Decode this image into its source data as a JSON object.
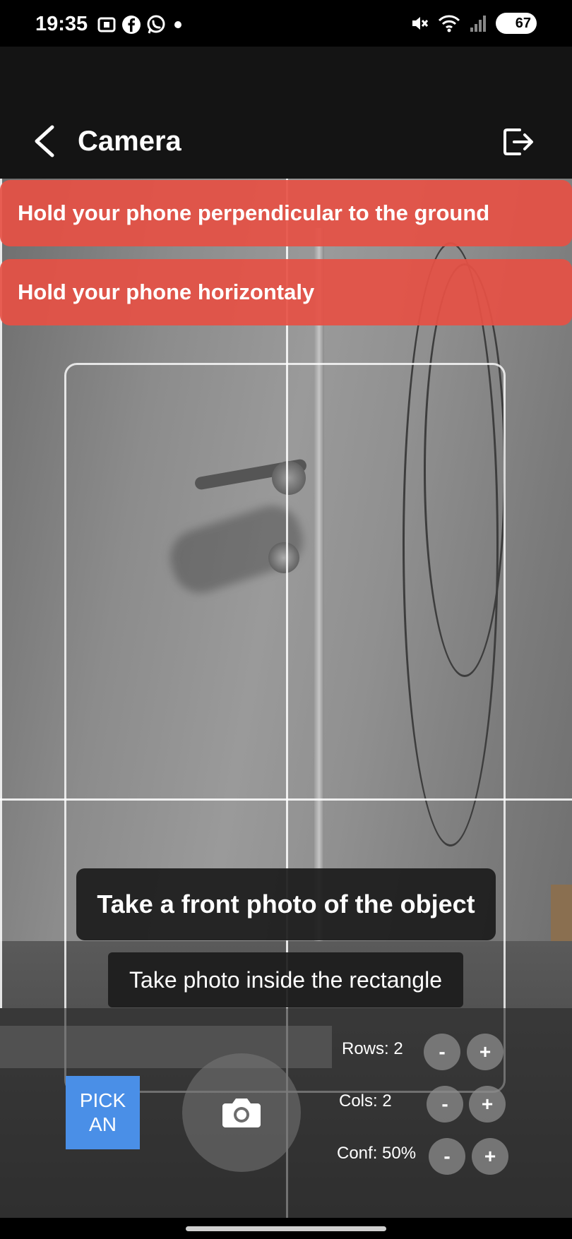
{
  "status_bar": {
    "time": "19:35",
    "left_icons": [
      "screenshot-icon",
      "facebook-icon",
      "whatsapp-icon",
      "dot-icon"
    ],
    "right_icons": [
      "mute-icon",
      "wifi-icon",
      "signal-icon"
    ],
    "battery": "67"
  },
  "app_bar": {
    "title": "Camera",
    "back_icon": "chevron-left-icon",
    "logout_icon": "logout-icon"
  },
  "warnings": [
    "Hold your phone perpendicular to the ground",
    "Hold your phone horizontaly"
  ],
  "warning_color": "#e6504a",
  "instructions": {
    "main": "Take a front photo of the object",
    "sub": "Take photo inside the rectangle"
  },
  "controls": {
    "pick_label_line1": "PICK",
    "pick_label_line2": "AN",
    "pick_color": "#4a8fe7",
    "rows_label": "Rows: 2",
    "cols_label": "Cols: 2",
    "conf_label": "Conf: 50%",
    "minus": "-",
    "plus": "+",
    "shutter_icon": "camera-icon"
  }
}
